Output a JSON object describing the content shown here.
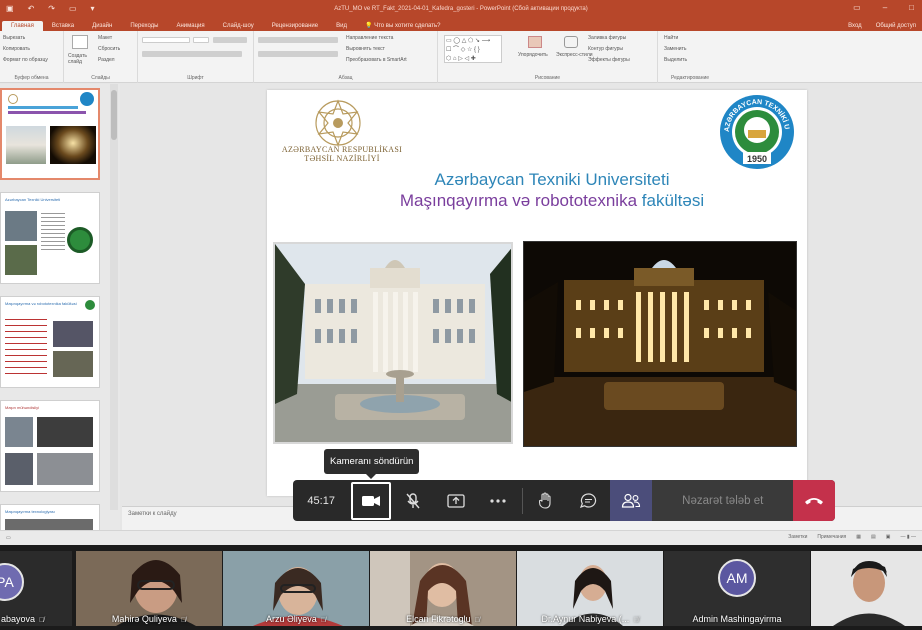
{
  "window": {
    "title": "AzTU_MO ve RT_Fakt_2021-04-01_Kafedra_gosteri - PowerPoint (Сбой активации продукта)"
  },
  "ribbon": {
    "tabs": [
      "Главная",
      "Вставка",
      "Дизайн",
      "Переходы",
      "Анимация",
      "Слайд-шоу",
      "Рецензирование",
      "Вид"
    ],
    "tell_me": "Что вы хотите сделать?",
    "right_items": [
      "Вход",
      "Общий доступ"
    ],
    "groups": {
      "clipboard": {
        "label": "Буфер обмена",
        "items": [
          "Вырезать",
          "Копировать",
          "Формат по образцу"
        ]
      },
      "slides": {
        "label": "Слайды",
        "new_slide": "Создать слайд",
        "items": [
          "Макет",
          "Сбросить",
          "Раздел"
        ]
      },
      "font": {
        "label": "Шрифт"
      },
      "paragraph": {
        "label": "Абзац",
        "items": [
          "Направление текста",
          "Выровнять текст",
          "Преобразовать в SmartArt"
        ]
      },
      "drawing": {
        "label": "Рисование",
        "arrange": "Упорядочить",
        "styles": "Экспресс-стили",
        "items": [
          "Заливка фигуры",
          "Контур фигуры",
          "Эффекты фигуры"
        ]
      },
      "editing": {
        "label": "Редактирование",
        "items": [
          "Найти",
          "Заменить",
          "Выделить"
        ]
      }
    }
  },
  "thumbnails": [
    {
      "number": "1",
      "selected": true,
      "title": ""
    },
    {
      "number": "2",
      "selected": false,
      "title": "Azərbaycan Texniki Universiteti"
    },
    {
      "number": "3",
      "selected": false,
      "title": "Maşınqayırma və robototexnika fakültəsi"
    },
    {
      "number": "4",
      "selected": false,
      "title": "Maşın mühəndisliyi"
    },
    {
      "number": "5",
      "selected": false,
      "title": "Maşınqayırma texnologiyası"
    }
  ],
  "slide": {
    "ministry_line1": "AZƏRBAYCAN RESPUBLİKASI",
    "ministry_line2": "TƏHSİL NAZİRLİYİ",
    "university": "Azərbaycan Texniki Universiteti",
    "faculty_main": "Maşınqayırma və robototexnika",
    "faculty_suffix": "fakültəsi",
    "logo_text": "AZƏRBAYCAN TEXNİKİ UNİVERSİTETİ",
    "logo_year": "1950"
  },
  "notes_placeholder": "Заметки к слайду",
  "status": {
    "notes": "Заметки",
    "comments": "Примечания"
  },
  "meeting": {
    "tooltip": "Kameranı söndürün",
    "timer": "45:17",
    "request_control": "Nəzarət tələb et",
    "colors": {
      "bar": "#292929",
      "hangup": "#c4314b",
      "active": "#4b4d7a"
    },
    "icons": [
      "camera-icon",
      "mic-off-icon",
      "share-screen-icon",
      "more-icon",
      "raise-hand-icon",
      "chat-icon",
      "participants-icon",
      "hang-up-icon"
    ]
  },
  "participants": [
    {
      "name": "abayova",
      "initials": "PA"
    },
    {
      "name": "Mahirə Quliyeva"
    },
    {
      "name": "Arzu Əliyeva"
    },
    {
      "name": "Elcan Fikrətoglu"
    },
    {
      "name": "Dr.Aynur Nabiyeva (..."
    },
    {
      "name": "Admin Mashingayirma",
      "initials": "AM"
    },
    {
      "name": ""
    }
  ]
}
